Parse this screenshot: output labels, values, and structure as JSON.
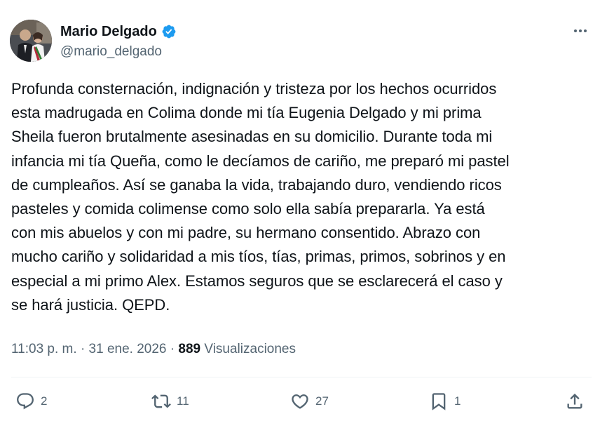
{
  "author": {
    "name": "Mario Delgado",
    "handle": "@mario_delgado",
    "verified": true
  },
  "tweet": {
    "text": "Profunda consternación, indignación y tristeza por los hechos ocurridos\nesta madrugada en Colima donde mi tía Eugenia Delgado y mi prima\nSheila fueron brutalmente asesinadas en su domicilio. Durante toda mi\ninfancia mi tía Queña, como le decíamos de cariño, me preparó mi pastel\nde cumpleaños. Así se ganaba la vida, trabajando duro, vendiendo ricos\npasteles y comida colimense como solo ella sabía prepararla. Ya está\ncon mis abuelos y con mi padre, su hermano consentido. Abrazo con\nmucho cariño y solidaridad a mis tíos, tías, primas, primos, sobrinos y en\nespecial a mi primo Alex. Estamos seguros que se esclarecerá el caso y\nse hará justicia. QEPD."
  },
  "meta": {
    "time": "11:03 p. m.",
    "separator": "·",
    "date": "31 ene. 2026",
    "views_count": "889",
    "views_label": "Visualizaciones"
  },
  "actions": {
    "replies": "2",
    "retweets": "11",
    "likes": "27",
    "bookmarks": "1"
  },
  "icons": {
    "verified": "verified-badge-icon",
    "more": "more-options-icon",
    "reply": "reply-icon",
    "retweet": "retweet-icon",
    "like": "heart-icon",
    "bookmark": "bookmark-icon",
    "share": "share-icon"
  },
  "colors": {
    "text": "#0f1419",
    "secondary": "#536471",
    "verified": "#1d9bf0",
    "divider": "#eff3f4"
  }
}
